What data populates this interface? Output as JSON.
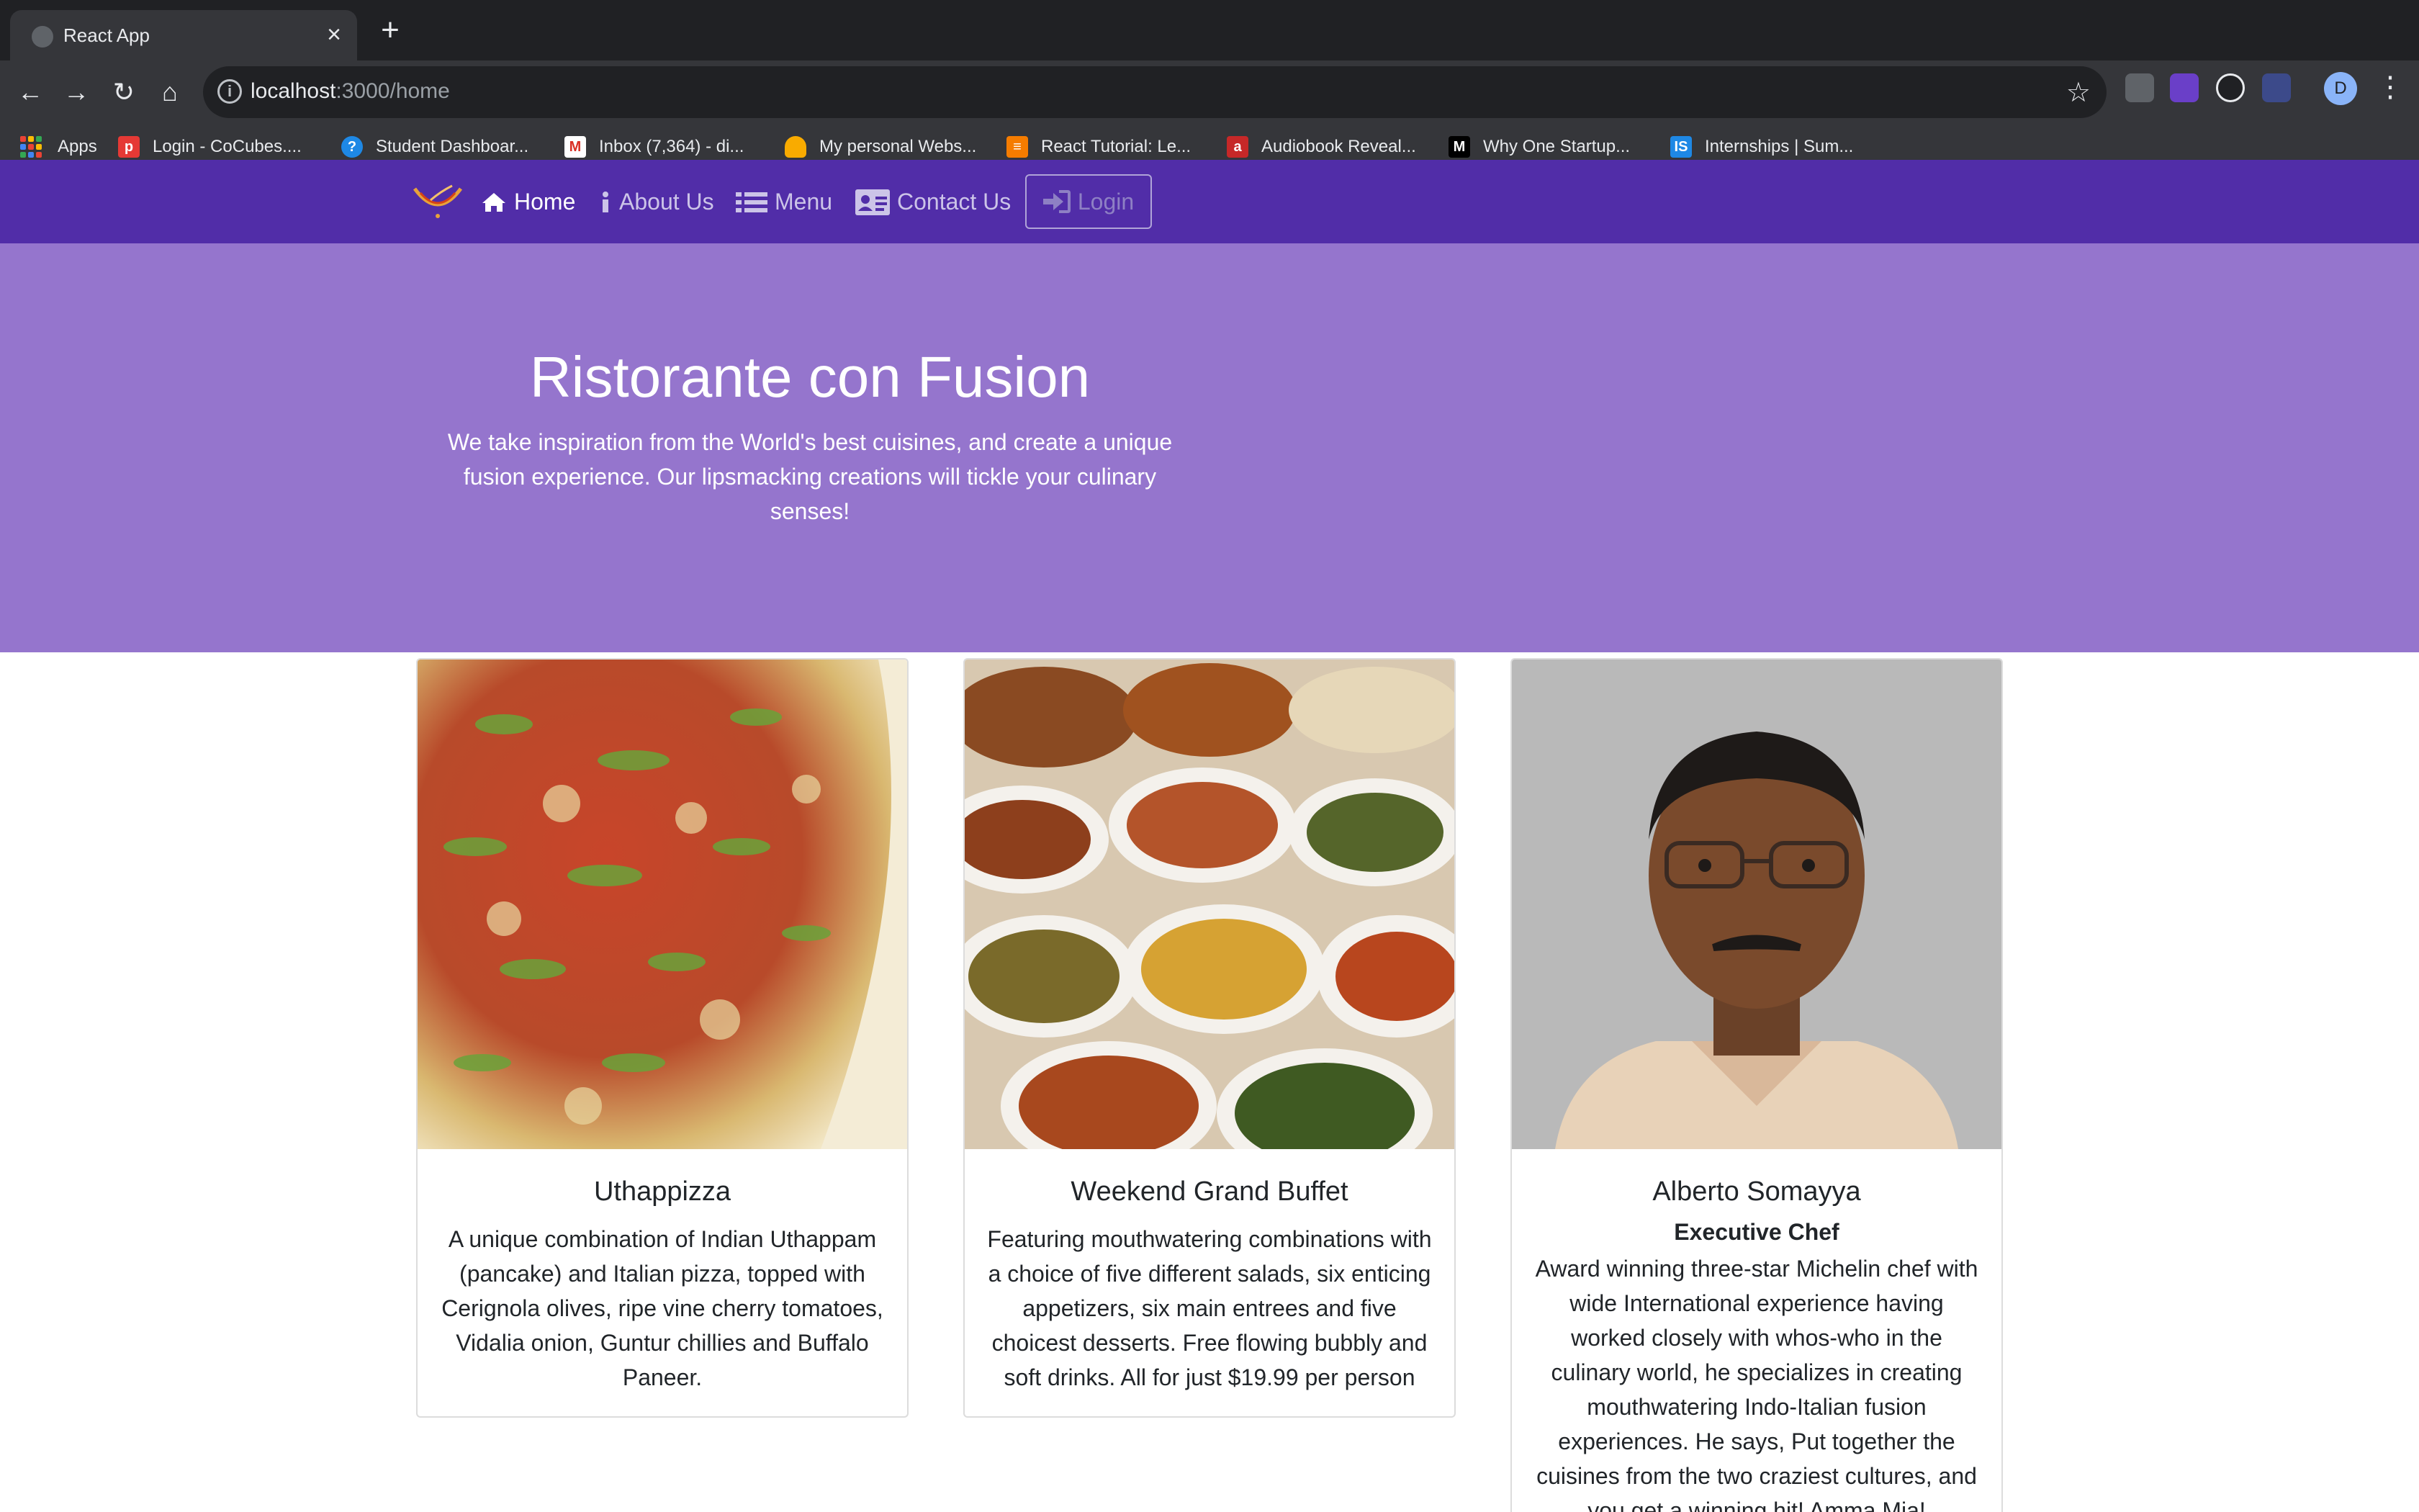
{
  "browser": {
    "tab_title": "React App",
    "url_host": "localhost",
    "url_path": ":3000/home",
    "avatar_letter": "D",
    "bookmarks": [
      {
        "label": "Apps",
        "icon": "apps-grid-icon"
      },
      {
        "label": "Login - CoCubes....",
        "icon": "cocubes-icon",
        "color": "#e53935"
      },
      {
        "label": "Student Dashboar...",
        "icon": "dashboard-icon",
        "color": "#1e88e5"
      },
      {
        "label": "Inbox (7,364) - di...",
        "icon": "gmail-icon",
        "color": "#d93025"
      },
      {
        "label": "My personal Webs...",
        "icon": "hand-icon",
        "color": "#f9ab00"
      },
      {
        "label": "React Tutorial: Le...",
        "icon": "react-tutorial-icon",
        "color": "#f57c00"
      },
      {
        "label": "Audiobook Reveal...",
        "icon": "audiobook-icon",
        "color": "#c62828"
      },
      {
        "label": "Why One Startup...",
        "icon": "medium-icon",
        "color": "#000000"
      },
      {
        "label": "Internships | Sum...",
        "icon": "internshala-icon",
        "color": "#1e88e5"
      }
    ]
  },
  "nav": {
    "items": [
      {
        "label": "Home",
        "icon": "home-icon",
        "active": true
      },
      {
        "label": "About Us",
        "icon": "info-icon"
      },
      {
        "label": "Menu",
        "icon": "list-icon"
      },
      {
        "label": "Contact Us",
        "icon": "address-card-icon"
      }
    ],
    "login_label": "Login",
    "brand_color": "#512da8"
  },
  "jumbotron": {
    "title": "Ristorante con Fusion",
    "text": "We take inspiration from the World's best cuisines, and create a unique fusion experience. Our lipsmacking creations will tickle your culinary senses!",
    "color": "#9575cd"
  },
  "cards": [
    {
      "title": "Uthappizza",
      "subtitle": "",
      "text": "A unique combination of Indian Uthappam (pancake) and Italian pizza, topped with Cerignola olives, ripe vine cherry tomatoes, Vidalia onion, Guntur chillies and Buffalo Paneer."
    },
    {
      "title": "Weekend Grand Buffet",
      "subtitle": "",
      "text": "Featuring mouthwatering combinations with a choice of five different salads, six enticing appetizers, six main entrees and five choicest desserts. Free flowing bubbly and soft drinks. All for just $19.99 per person"
    },
    {
      "title": "Alberto Somayya",
      "subtitle": "Executive Chef",
      "text": "Award winning three-star Michelin chef with wide International experience having worked closely with whos-who in the culinary world, he specializes in creating mouthwatering Indo-Italian fusion experiences. He says, Put together the cuisines from the two craziest cultures, and you get a winning hit! Amma Mia!"
    }
  ]
}
